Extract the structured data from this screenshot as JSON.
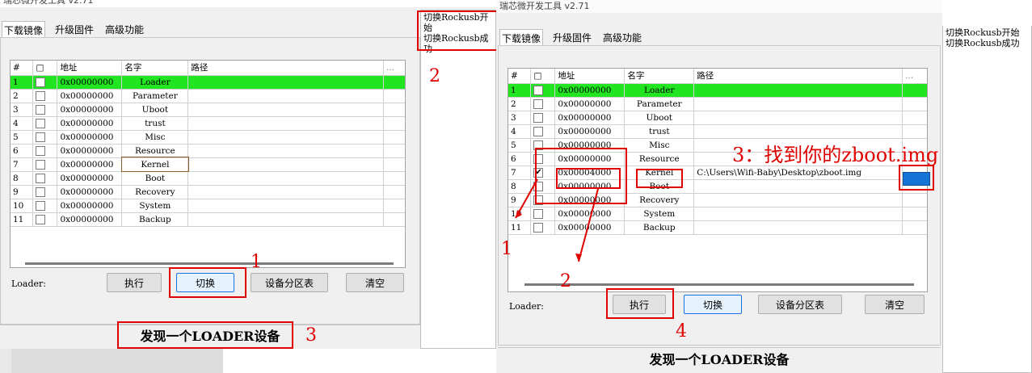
{
  "left_window": {
    "title": "瑞芯微开发工具 v2.71",
    "tabs": [
      "下载镜像",
      "升级固件",
      "高级功能"
    ],
    "log_lines": [
      "切换Rockusb开始",
      "切换Rockusb成功"
    ],
    "columns": [
      "#",
      "□",
      "地址",
      "名字",
      "路径",
      "..."
    ],
    "rows": [
      {
        "num": "1",
        "addr": "0x00000000",
        "name": "Loader",
        "path": "",
        "checked": false,
        "selected": true
      },
      {
        "num": "2",
        "addr": "0x00000000",
        "name": "Parameter",
        "path": "",
        "checked": false
      },
      {
        "num": "3",
        "addr": "0x00000000",
        "name": "Uboot",
        "path": "",
        "checked": false
      },
      {
        "num": "4",
        "addr": "0x00000000",
        "name": "trust",
        "path": "",
        "checked": false
      },
      {
        "num": "5",
        "addr": "0x00000000",
        "name": "Misc",
        "path": "",
        "checked": false
      },
      {
        "num": "6",
        "addr": "0x00000000",
        "name": "Resource",
        "path": "",
        "checked": false
      },
      {
        "num": "7",
        "addr": "0x00000000",
        "name": "Kernel",
        "path": "",
        "checked": false
      },
      {
        "num": "8",
        "addr": "0x00000000",
        "name": "Boot",
        "path": "",
        "checked": false
      },
      {
        "num": "9",
        "addr": "0x00000000",
        "name": "Recovery",
        "path": "",
        "checked": false
      },
      {
        "num": "10",
        "addr": "0x00000000",
        "name": "System",
        "path": "",
        "checked": false
      },
      {
        "num": "11",
        "addr": "0x00000000",
        "name": "Backup",
        "path": "",
        "checked": false
      }
    ],
    "loader_label": "Loader:",
    "buttons": {
      "run": "执行",
      "switch": "切换",
      "partition": "设备分区表",
      "clear": "清空"
    },
    "status": "发现一个LOADER设备"
  },
  "right_window": {
    "title": "瑞芯微开发工具 v2.71",
    "tabs": [
      "下载镜像",
      "升级固件",
      "高级功能"
    ],
    "log_lines": [
      "切换Rockusb开始",
      "切换Rockusb成功"
    ],
    "columns": [
      "#",
      "□",
      "地址",
      "名字",
      "路径",
      "..."
    ],
    "rows": [
      {
        "num": "1",
        "addr": "0x00000000",
        "name": "Loader",
        "path": "",
        "checked": false,
        "selected": true
      },
      {
        "num": "2",
        "addr": "0x00000000",
        "name": "Parameter",
        "path": "",
        "checked": false
      },
      {
        "num": "3",
        "addr": "0x00000000",
        "name": "Uboot",
        "path": "",
        "checked": false
      },
      {
        "num": "4",
        "addr": "0x00000000",
        "name": "trust",
        "path": "",
        "checked": false
      },
      {
        "num": "5",
        "addr": "0x00000000",
        "name": "Misc",
        "path": "",
        "checked": false
      },
      {
        "num": "6",
        "addr": "0x00000000",
        "name": "Resource",
        "path": "",
        "checked": false
      },
      {
        "num": "7",
        "addr": "0x00004000",
        "name": "Kernel",
        "path": "C:\\Users\\Wifi-Baby\\Desktop\\zboot.img",
        "checked": true
      },
      {
        "num": "8",
        "addr": "0x00000000",
        "name": "Boot",
        "path": "",
        "checked": false
      },
      {
        "num": "9",
        "addr": "0x00000000",
        "name": "Recovery",
        "path": "",
        "checked": false
      },
      {
        "num": "10",
        "addr": "0x00000000",
        "name": "System",
        "path": "",
        "checked": false
      },
      {
        "num": "11",
        "addr": "0x00000000",
        "name": "Backup",
        "path": "",
        "checked": false
      }
    ],
    "loader_label": "Loader:",
    "buttons": {
      "run": "执行",
      "switch": "切换",
      "partition": "设备分区表",
      "clear": "清空"
    },
    "status": "发现一个LOADER设备"
  },
  "annotations": {
    "left": [
      "1",
      "2",
      "3"
    ],
    "right_steps": [
      "1",
      "2",
      "4"
    ],
    "right_callout": "3：找到你的zboot.img"
  },
  "colors": {
    "selected_row": "#22e522",
    "annotation": "#e00000",
    "browse_button": "#1673d6"
  }
}
